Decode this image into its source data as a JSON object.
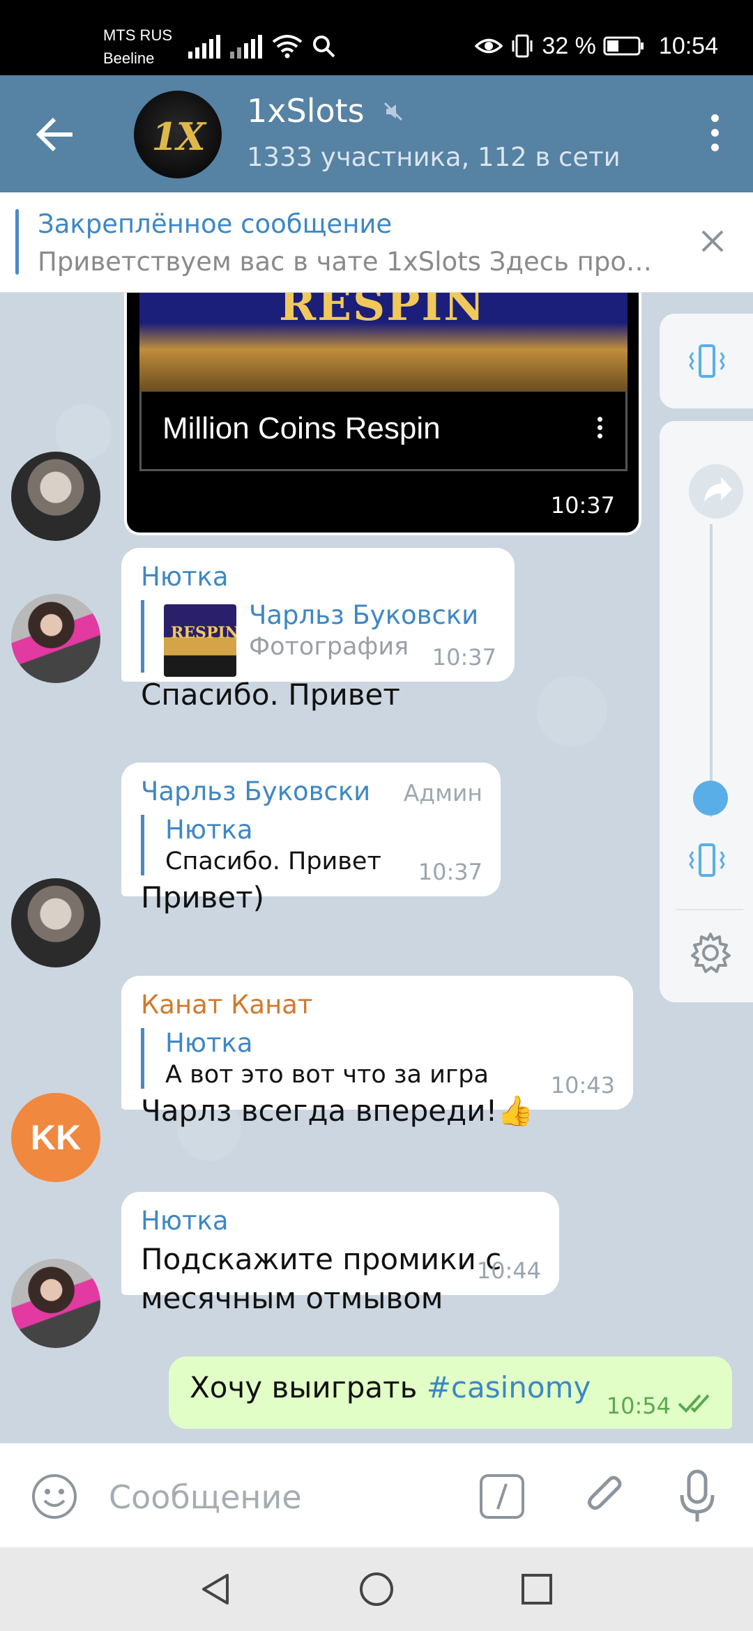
{
  "status_bar": {
    "carrier_1": "MTS RUS",
    "carrier_2": "Beeline",
    "battery": "32 %",
    "time": "10:54"
  },
  "header": {
    "title": "1xSlots",
    "subtitle": "1333 участника, 112 в сети",
    "avatar_text": "1X"
  },
  "pinned": {
    "title": "Закреплённое сообщение",
    "text": "Приветствуем вас в чате 1xSlots  Здесь про…"
  },
  "messages": {
    "video": {
      "thumb_text": "RESPIN",
      "title": "Million Coins Respin",
      "time": "10:37"
    },
    "m1": {
      "sender": "Нютка",
      "reply_name": "Чарльз Буковски",
      "reply_text": "Фотография",
      "thumb_text": "RESPIN",
      "text": "Спасибо. Привет",
      "time": "10:37"
    },
    "m2": {
      "sender": "Чарльз Буковски",
      "badge": "Админ",
      "reply_name": "Нютка",
      "reply_text": "Спасибо. Привет",
      "text": "Привет)",
      "time": "10:37"
    },
    "m3": {
      "sender": "Канат Канат",
      "avatar_initials": "KK",
      "reply_name": "Нютка",
      "reply_text": "А вот это вот что за игра",
      "text": "Чарлз всегда впереди!👍",
      "time": "10:43"
    },
    "m4": {
      "sender": "Нютка",
      "text_line1": "Подскажите промики с",
      "text_line2": "месячным отмывом",
      "time": "10:44"
    },
    "out": {
      "text": "Хочу выиграть ",
      "hashtag": "#casinomy",
      "time": "10:54"
    }
  },
  "input": {
    "placeholder": "Сообщение"
  },
  "colors": {
    "header": "#5682a3",
    "accent": "#3d87c6",
    "outgoing_bubble": "#e1fec6",
    "kk_avatar": "#f1883f"
  }
}
